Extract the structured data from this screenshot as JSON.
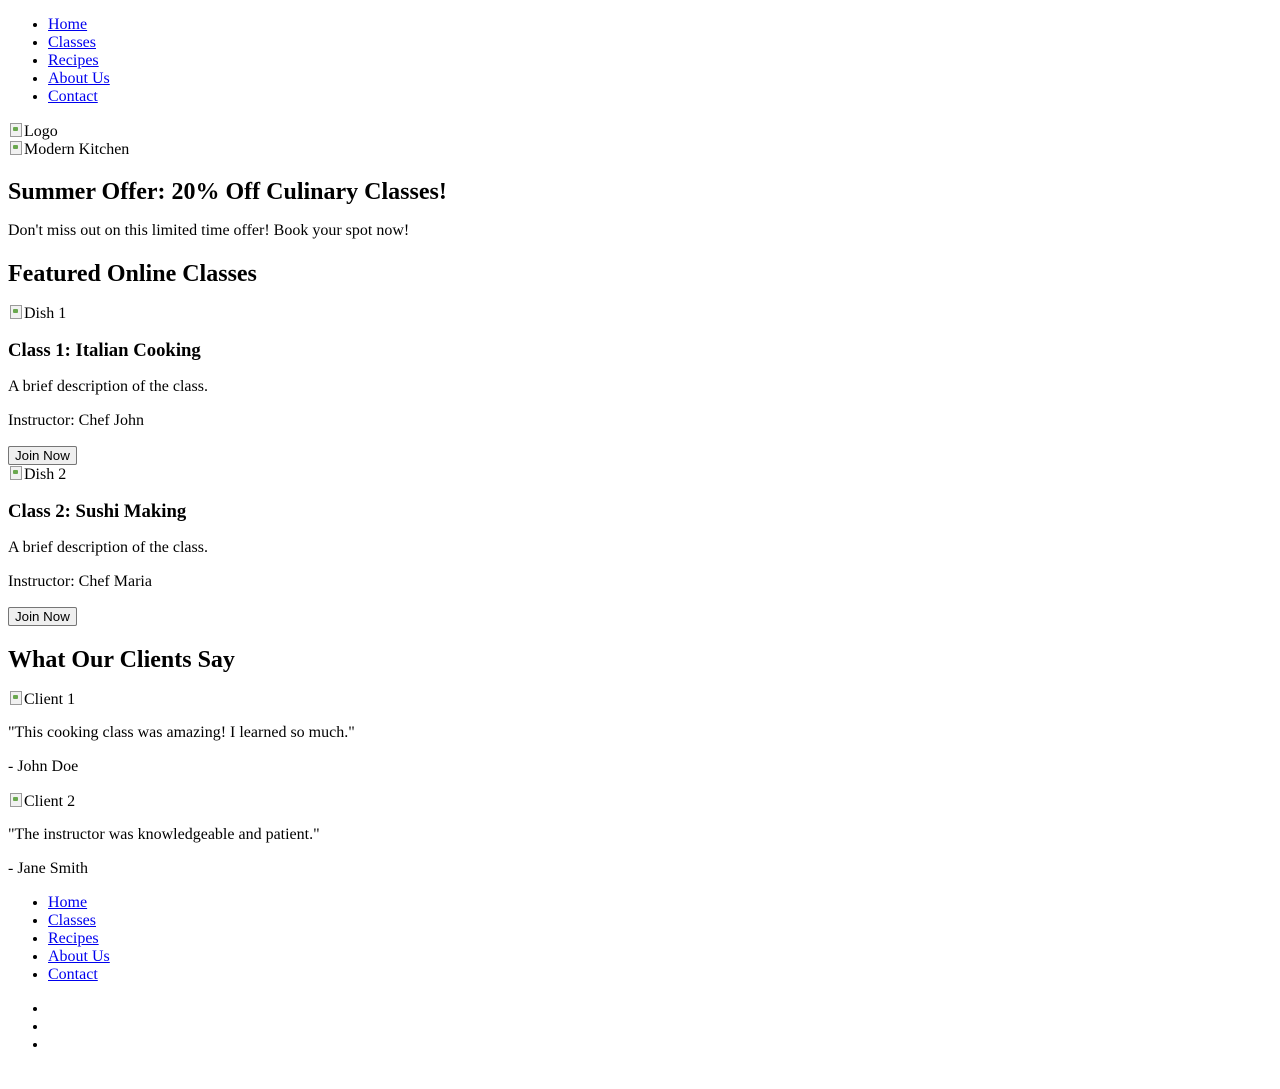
{
  "header_nav": {
    "items": [
      "Home",
      "Classes",
      "Recipes",
      "About Us",
      "Contact"
    ]
  },
  "images": {
    "logo_alt": "Logo",
    "hero_alt": "Modern Kitchen"
  },
  "offer": {
    "title": "Summer Offer: 20% Off Culinary Classes!",
    "text": "Don't miss out on this limited time offer! Book your spot now!"
  },
  "featured": {
    "heading": "Featured Online Classes",
    "classes": [
      {
        "image_alt": "Dish 1",
        "title": "Class 1: Italian Cooking",
        "description": "A brief description of the class.",
        "instructor": "Instructor: Chef John",
        "button": "Join Now"
      },
      {
        "image_alt": "Dish 2",
        "title": "Class 2: Sushi Making",
        "description": "A brief description of the class.",
        "instructor": "Instructor: Chef Maria",
        "button": "Join Now"
      }
    ]
  },
  "testimonials": {
    "heading": "What Our Clients Say",
    "items": [
      {
        "image_alt": "Client 1",
        "quote": "\"This cooking class was amazing! I learned so much.\"",
        "author": "- John Doe"
      },
      {
        "image_alt": "Client 2",
        "quote": "\"The instructor was knowledgeable and patient.\"",
        "author": "- Jane Smith"
      }
    ]
  },
  "footer_nav": {
    "items": [
      "Home",
      "Classes",
      "Recipes",
      "About Us",
      "Contact"
    ]
  },
  "social": {
    "items": [
      "",
      "",
      ""
    ]
  }
}
